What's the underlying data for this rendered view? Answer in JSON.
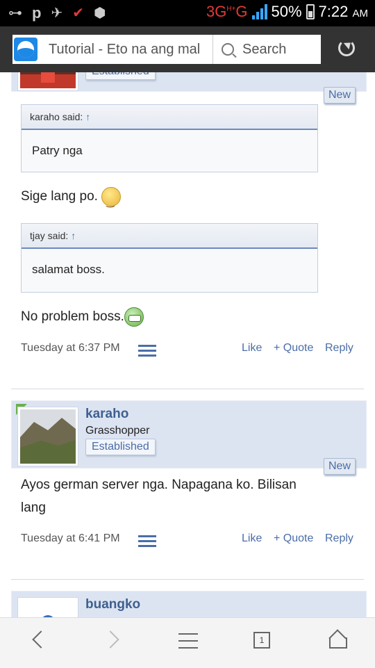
{
  "status_bar": {
    "network": "3G",
    "network_sup": "H+",
    "network_letter": "G",
    "battery": "50%",
    "time": "7:22",
    "ampm": "AM"
  },
  "browser": {
    "url_text": "Tutorial - Eto na ang mal",
    "search_placeholder": "Search",
    "tab_count": "1"
  },
  "post1": {
    "badge": "Established",
    "new_label": "New",
    "quote1": {
      "author": "karaho said:",
      "arrow": "↑",
      "text": "Patry nga"
    },
    "reply1": "Sige lang po.",
    "quote2": {
      "author": "tjay said:",
      "arrow": "↑",
      "text": "salamat boss."
    },
    "reply2": "No problem boss.",
    "timestamp": "Tuesday at 6:37 PM",
    "actions": {
      "like": "Like",
      "quote": "+ Quote",
      "reply": "Reply"
    }
  },
  "post2": {
    "name": "karaho",
    "title": "Grasshopper",
    "badge": "Established",
    "new_label": "New",
    "message": "Ayos german server nga. Napagana ko. Bilisan lang",
    "timestamp": "Tuesday at 6:41 PM",
    "actions": {
      "like": "Like",
      "quote": "+ Quote",
      "reply": "Reply"
    }
  },
  "post3": {
    "name": "buangko"
  },
  "colors": {
    "link": "#4a6da7",
    "header_bg": "#dce4f2",
    "toolbar_bg": "#333333"
  }
}
